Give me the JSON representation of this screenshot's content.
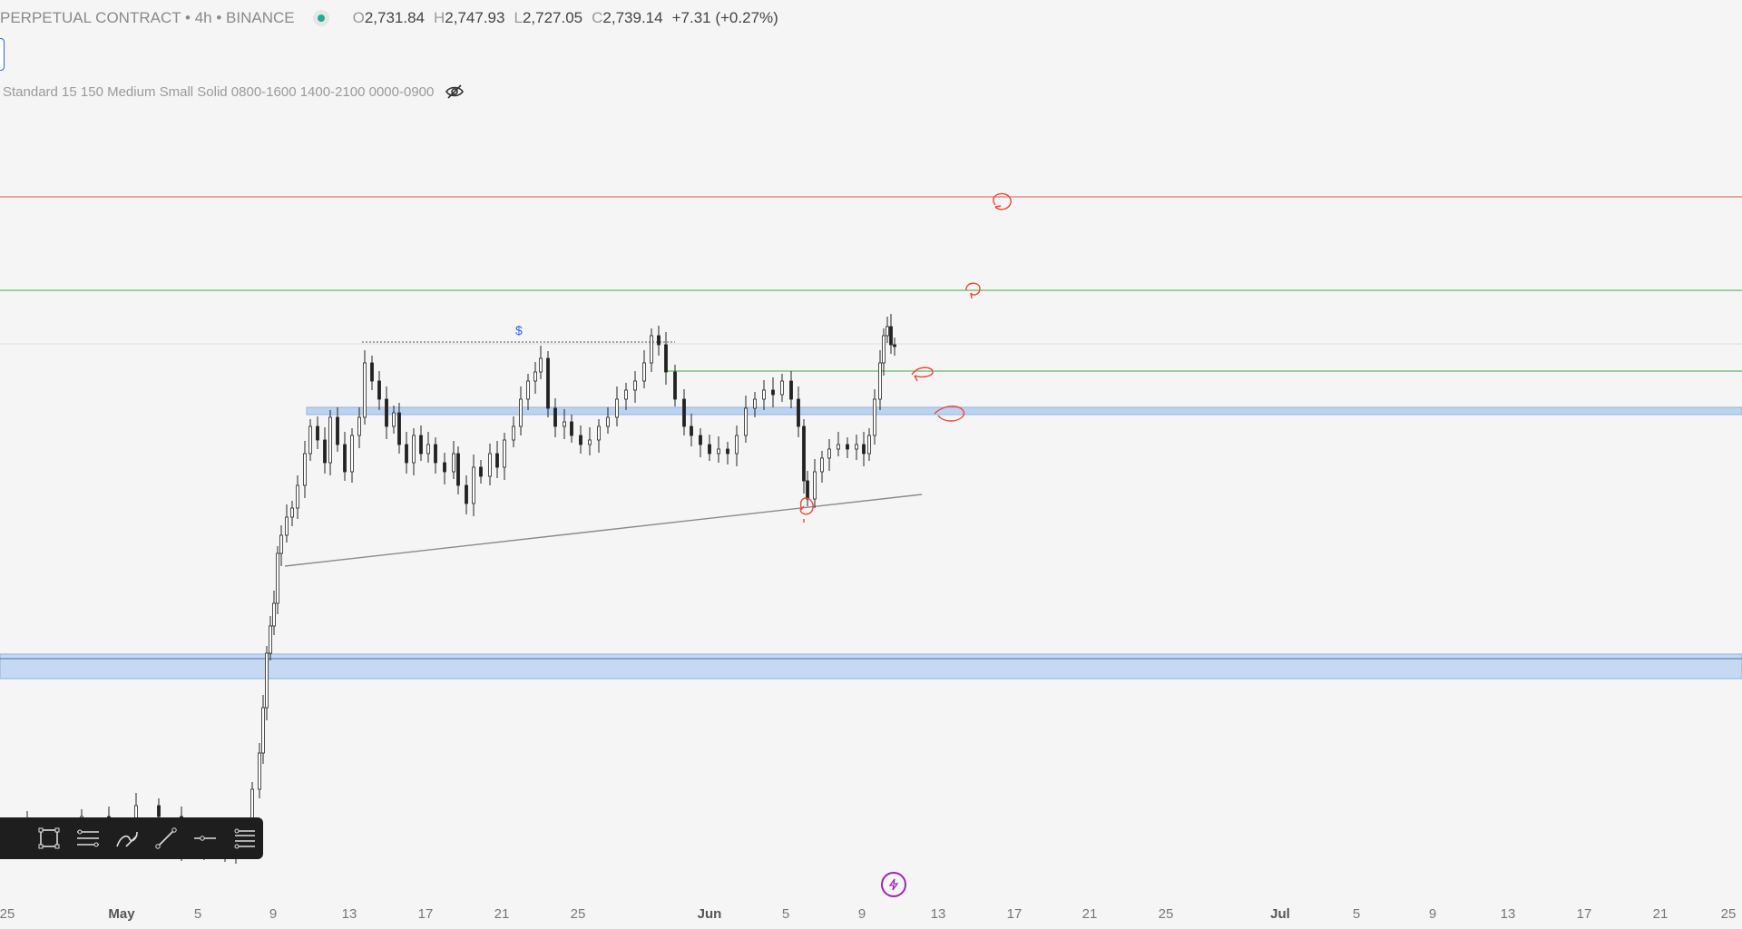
{
  "header": {
    "symbol": "PERPETUAL CONTRACT • 4h • BINANCE",
    "open_label": "O",
    "open": "2,731.84",
    "high_label": "H",
    "high": "2,747.93",
    "low_label": "L",
    "low": "2,727.05",
    "close_label": "C",
    "close": "2,739.14",
    "change": "+7.31 (+0.27%)"
  },
  "indicator": {
    "label": "Standard 15 150 Medium Small Solid 0800-1600 1400-2100 0000-0900",
    "visibility_icon": "eye-slash-icon"
  },
  "annotations": {
    "dollar_marker": "$"
  },
  "drawing_toolbar": {
    "tools": [
      "rectangle-icon",
      "parallel-channel-icon",
      "brush-icon",
      "trend-line-icon",
      "horizontal-line-icon",
      "fib-icon"
    ]
  },
  "time_axis": {
    "ticks": [
      "25",
      "May",
      "5",
      "9",
      "13",
      "17",
      "21",
      "25",
      "Jun",
      "5",
      "9",
      "13",
      "17",
      "21",
      "25",
      "Jul",
      "5",
      "9",
      "13",
      "17",
      "21",
      "25"
    ]
  },
  "colors": {
    "background": "#f5f5f5",
    "resistance_red": "#e57373",
    "level_green": "#66bb6a",
    "zone_blue": "#bbd3f0",
    "marker_red": "#f44336",
    "candle": "#222222"
  },
  "chart_data": {
    "type": "candlestick",
    "symbol": "PERPETUAL CONTRACT",
    "interval": "4h",
    "exchange": "BINANCE",
    "last_ohlc": {
      "open": 2731.84,
      "high": 2747.93,
      "low": 2727.05,
      "close": 2739.14,
      "change": 7.31,
      "change_pct": 0.27
    },
    "x_tick_labels": [
      "25",
      "May",
      "5",
      "9",
      "13",
      "17",
      "21",
      "25",
      "Jun",
      "5",
      "9",
      "13",
      "17",
      "21",
      "25",
      "Jul",
      "5",
      "9",
      "13",
      "17",
      "21",
      "25"
    ],
    "horizontal_levels": [
      {
        "color": "red"
      },
      {
        "color": "green"
      },
      {
        "color": "green"
      }
    ],
    "zones": [
      {
        "color": "blue"
      },
      {
        "color": "blue"
      }
    ],
    "trendline": {
      "style": "solid"
    },
    "grid": false
  }
}
